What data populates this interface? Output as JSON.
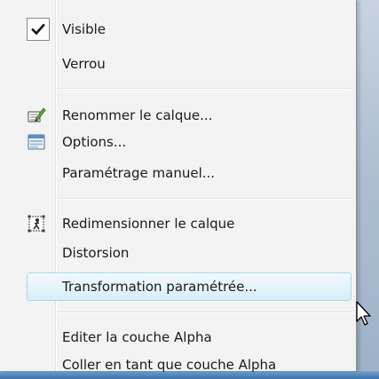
{
  "menu": {
    "items": [
      {
        "label": "Visible",
        "checked": true,
        "icon": "checkmark-icon"
      },
      {
        "label": "Verrou"
      },
      {
        "label": "Renommer le calque...",
        "icon": "rename-pencil-icon"
      },
      {
        "label": "Options...",
        "icon": "options-window-icon"
      },
      {
        "label": "Paramétrage manuel..."
      },
      {
        "label": "Redimensionner le calque",
        "icon": "resize-figure-icon"
      },
      {
        "label": "Distorsion"
      },
      {
        "label": "Transformation paramétrée...",
        "highlighted": true
      },
      {
        "label": "Editer la couche Alpha"
      },
      {
        "label": "Coller en tant que couche Alpha"
      }
    ],
    "colors": {
      "background": "#f3f3f3",
      "highlight_border": "#a8d8eb",
      "highlight_fill": "#d8eff9",
      "text": "#1a1a1a"
    }
  },
  "cursor": {
    "icon": "mouse-pointer-icon"
  }
}
